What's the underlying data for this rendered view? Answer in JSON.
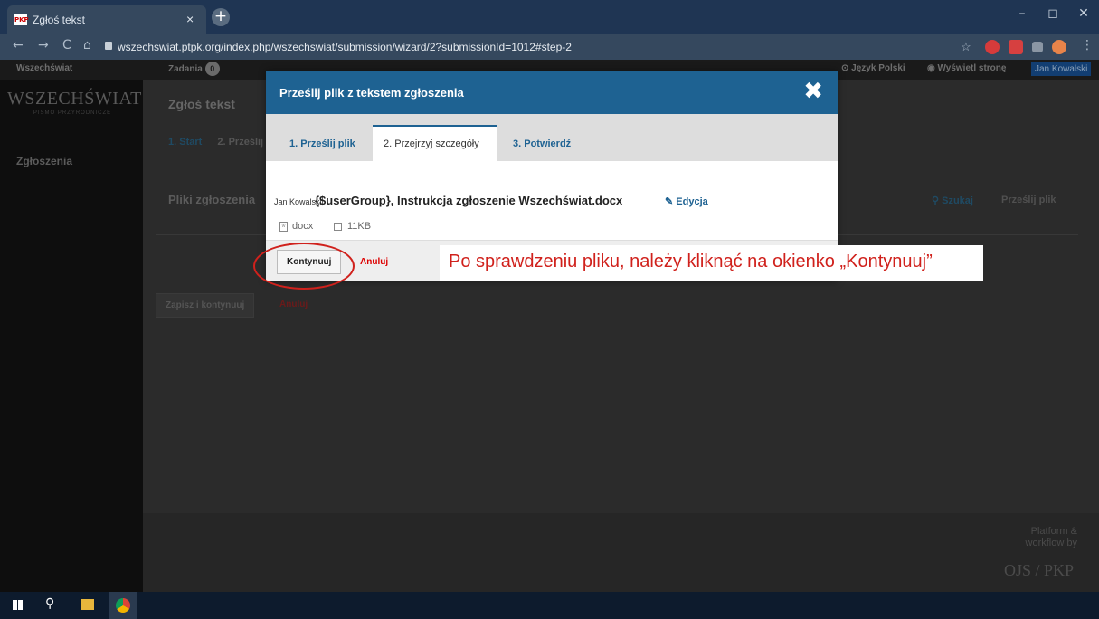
{
  "browser": {
    "tab_title": "Zgłoś tekst",
    "favicon_text": "PKP",
    "tab_close": "×",
    "new_tab": "+",
    "window_controls": [
      "–",
      "◻",
      "✕"
    ],
    "url": "wszechswiat.ptpk.org/index.php/wszechswiat/submission/wizard/2?submissionId=1012#step-2",
    "nav": {
      "back": "←",
      "forward": "→",
      "reload": "C",
      "home": "⌂"
    },
    "star": "☆"
  },
  "app_header": {
    "journal": "Wszechświat",
    "tasks_label": "Zadania",
    "tasks_count": "0",
    "language": "Język Polski",
    "view_site": "Wyświetl stronę",
    "user": "Jan Kowalski"
  },
  "sidebar": {
    "logo": "WSZECHŚWIAT",
    "logo_sub": "PISMO PRZYRODNICZE",
    "item": "Zgłoszenia"
  },
  "main": {
    "title": "Zgłoś tekst",
    "tabs": [
      "1. Start",
      "2. Prześlij"
    ],
    "files_title": "Pliki zgłoszenia",
    "search": "Szukaj",
    "upload": "Prześlij plik",
    "save": "Zapisz i kontynuuj",
    "cancel": "Anuluj"
  },
  "footer": {
    "line1": "Platform &",
    "line2": "workflow by",
    "logo": "OJS / PKP"
  },
  "modal": {
    "title": "Prześlij plik z tekstem zgłoszenia",
    "close": "✖",
    "tabs": [
      "1. Prześlij plik",
      "2. Przejrzyj szczegóły",
      "3. Potwierdź"
    ],
    "active_tab": 1,
    "file": {
      "author": "Jan Kowalski",
      "name": "{$userGroup}, Instrukcja zgłoszenie Wszechświat.docx",
      "edit": "Edycja",
      "type": "docx",
      "size": "11KB"
    },
    "continue": "Kontynuuj",
    "cancel": "Anuluj"
  },
  "annotation": {
    "callout": "Po sprawdzeniu pliku, należy kliknąć na okienko „Kontynuuj”",
    "color": "#d0211c"
  },
  "colors": {
    "accent": "#1e6292",
    "danger": "#dd0000"
  }
}
